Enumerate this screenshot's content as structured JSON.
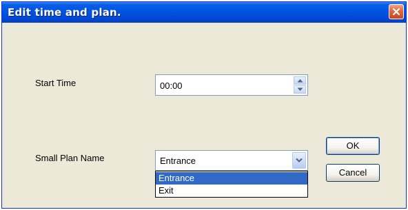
{
  "window": {
    "title": "Edit time and plan."
  },
  "form": {
    "start_time_label": "Start Time",
    "start_time_value": "00:00",
    "plan_name_label": "Small Plan Name",
    "plan_name_value": "Entrance",
    "plan_options": [
      "Entrance",
      "Exit"
    ],
    "plan_options_selected_index": 0
  },
  "buttons": {
    "ok_label": "OK",
    "cancel_label": "Cancel"
  },
  "icons": {
    "close": "close-icon",
    "spin_up": "arrow-up-icon",
    "spin_down": "arrow-down-icon",
    "dropdown": "chevron-down-icon"
  },
  "colors": {
    "titlebar": "#0054e3",
    "dialog_bg": "#ece9d8",
    "selection": "#316ac5",
    "close": "#e2643e"
  }
}
